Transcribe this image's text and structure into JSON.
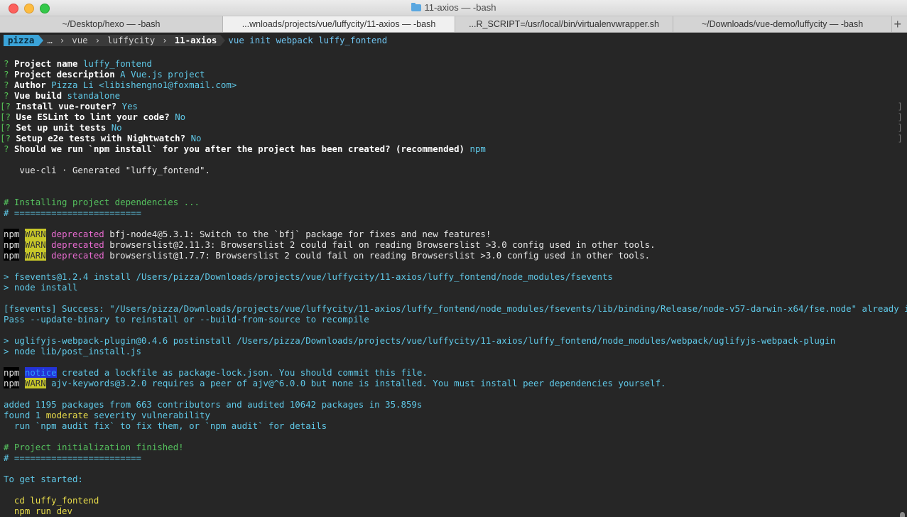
{
  "window": {
    "title": "11-axios — -bash"
  },
  "tabs": [
    {
      "label": "~/Desktop/hexo — -bash",
      "active": false
    },
    {
      "label": "...wnloads/projects/vue/luffycity/11-axios — -bash",
      "active": true
    },
    {
      "label": "...R_SCRIPT=/usr/local/bin/virtualenvwrapper.sh",
      "active": false
    },
    {
      "label": "~/Downloads/vue-demo/luffycity — -bash",
      "active": false
    }
  ],
  "new_tab": "+",
  "prompt": {
    "user": "pizza",
    "segments": [
      "…",
      "vue",
      "luffycity",
      "11-axios"
    ],
    "command": "vue init webpack luffy_fontend"
  },
  "questions": [
    {
      "mark": "?",
      "label": "Project name",
      "answer": "luffy_fontend",
      "bracket": ""
    },
    {
      "mark": "?",
      "label": "Project description",
      "answer": "A Vue.js project",
      "bracket": ""
    },
    {
      "mark": "?",
      "label": "Author",
      "answer": "Pizza Li <libishengno1@foxmail.com>",
      "bracket": ""
    },
    {
      "mark": "?",
      "label": "Vue build",
      "answer": "standalone",
      "bracket": ""
    },
    {
      "mark": "[?",
      "label": "Install vue-router?",
      "answer": "Yes",
      "bracket": "]"
    },
    {
      "mark": "[?",
      "label": "Use ESLint to lint your code?",
      "answer": "No",
      "bracket": "]"
    },
    {
      "mark": "[?",
      "label": "Set up unit tests",
      "answer": "No",
      "bracket": "]"
    },
    {
      "mark": "[?",
      "label": "Setup e2e tests with Nightwatch?",
      "answer": "No",
      "bracket": "]"
    },
    {
      "mark": "?",
      "label": "Should we run `npm install` for you after the project has been created? (recommended)",
      "answer": "npm",
      "bracket": ""
    }
  ],
  "generated": "   vue-cli · Generated \"luffy_fontend\".",
  "installing": {
    "heading": "# Installing project dependencies ...",
    "rule": "# ========================"
  },
  "warns": [
    {
      "npm": "npm",
      "tag": "WARN",
      "kind": "deprecated",
      "text": " bfj-node4@5.3.1: Switch to the `bfj` package for fixes and new features!"
    },
    {
      "npm": "npm",
      "tag": "WARN",
      "kind": "deprecated",
      "text": " browserslist@2.11.3: Browserslist 2 could fail on reading Browserslist >3.0 config used in other tools."
    },
    {
      "npm": "npm",
      "tag": "WARN",
      "kind": "deprecated",
      "text": " browserslist@1.7.7: Browserslist 2 could fail on reading Browserslist >3.0 config used in other tools."
    }
  ],
  "fsevents": {
    "line1": "> fsevents@1.2.4 install /Users/pizza/Downloads/projects/vue/luffycity/11-axios/luffy_fontend/node_modules/fsevents",
    "line2": "> node install",
    "line3": "[fsevents] Success: \"/Users/pizza/Downloads/projects/vue/luffycity/11-axios/luffy_fontend/node_modules/fsevents/lib/binding/Release/node-v57-darwin-x64/fse.node\" already installed",
    "line4": "Pass --update-binary to reinstall or --build-from-source to recompile"
  },
  "uglify": {
    "line1": "> uglifyjs-webpack-plugin@0.4.6 postinstall /Users/pizza/Downloads/projects/vue/luffycity/11-axios/luffy_fontend/node_modules/webpack/uglifyjs-webpack-plugin",
    "line2": "> node lib/post_install.js"
  },
  "notices": [
    {
      "npm": "npm",
      "tag": "notice",
      "text": " created a lockfile as package-lock.json. You should commit this file."
    },
    {
      "npm": "npm",
      "tag": "WARN",
      "text": " ajv-keywords@3.2.0 requires a peer of ajv@^6.0.0 but none is installed. You must install peer dependencies yourself."
    }
  ],
  "audit": {
    "added": "added 1195 packages from 663 contributors and audited 10642 packages in 35.859s",
    "found_pre": "found 1 ",
    "found_level": "moderate",
    "found_post": " severity vulnerability",
    "run": "  run `npm audit fix` to fix them, or `npm audit` for details"
  },
  "finished": {
    "heading": "# Project initialization finished!",
    "rule": "# ========================"
  },
  "get_started": {
    "label": "To get started:",
    "cmd1": "  cd luffy_fontend",
    "cmd2": "  npm run dev"
  },
  "colors": {
    "user_segment": "#3ba4d9",
    "path_segment": "#3a3a3a",
    "question_mark": "#56c456",
    "deprecated": "#e86bd0",
    "warn_badge": "#c8c829",
    "notice_badge": "#2433d6",
    "cyan_output": "#5fc9e8",
    "green_comment": "#55c25e",
    "yellow_highlight": "#e8dc4a"
  },
  "icons": [
    "close-light",
    "minimize-light",
    "maximize-light",
    "folder-icon"
  ]
}
